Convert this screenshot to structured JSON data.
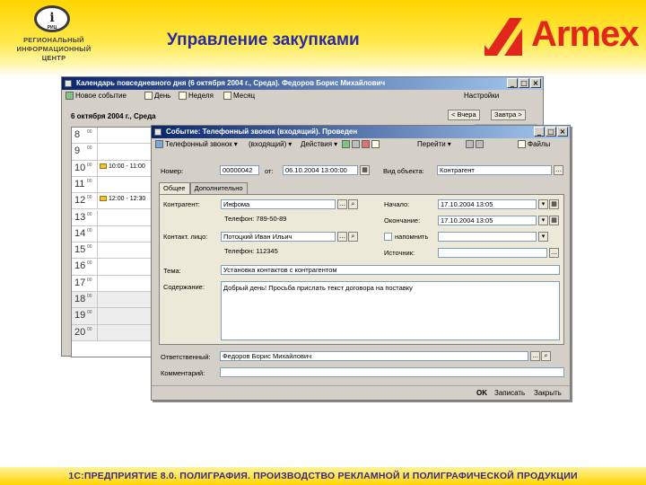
{
  "slide": {
    "title": "Управление закупками",
    "logo_left": {
      "seal_letter": "i",
      "seal_text": "РИЦ",
      "org_lines": [
        "РЕГИОНАЛЬНЫЙ",
        "ИНФОРМАЦИОННЫЙ",
        "ЦЕНТР"
      ]
    },
    "logo_right": {
      "brand": "Armex"
    },
    "footer": "1С:ПРЕДПРИЯТИЕ 8.0. ПОЛИГРАФИЯ. ПРОИЗВОДСТВО РЕКЛАМНОЙ И ПОЛИГРАФИЧЕСКОЙ ПРОДУКЦИИ",
    "colors": {
      "header_yellow": "#ffd400",
      "title_blue": "#2a2aa0",
      "brand_red": "#e1261c",
      "window_title_blue": "#0a246a"
    }
  },
  "calendar_window": {
    "title": "Календарь повседневного дня (6 октября 2004 г., Среда). Федоров Борис Михайлович",
    "toolbar": {
      "new_event": "Новое событие",
      "day": "День",
      "week": "Неделя",
      "month": "Месяц",
      "settings": "Настройки"
    },
    "date_header": "6 октября 2004 г., Среда",
    "nav": {
      "prev": "< Вчера",
      "next": "Завтра >"
    },
    "hours": [
      "8",
      "9",
      "10",
      "11",
      "12",
      "13",
      "14",
      "15",
      "16",
      "17",
      "18",
      "19",
      "20"
    ],
    "hour_suffix": "00",
    "events": [
      {
        "hour": "10",
        "text": "10:00 - 11:00"
      },
      {
        "hour": "12",
        "text": "12:00 - 12:30"
      }
    ]
  },
  "event_dialog": {
    "title": "Событие: Телефонный звонок (входящий). Проведен",
    "toolbar": {
      "type": "Телефонный звонок",
      "direction": "(входящий)",
      "actions": "Действия",
      "goto": "Перейти",
      "files": "Файлы"
    },
    "fields": {
      "number_label": "Номер:",
      "number_value": "00000042",
      "date_label": "от:",
      "date_value": "06.10.2004 13:00:00",
      "object_type_label": "Вид объекта:",
      "object_type_value": "Контрагент"
    },
    "tabs": [
      "Общее",
      "Дополнительно"
    ],
    "general": {
      "counterparty_label": "Контрагент:",
      "counterparty_value": "Инфома",
      "counterparty_phone": "Телефон: 789-50-89",
      "contact_label": "Контакт. лицо:",
      "contact_value": "Потоцкий Иван Ильич",
      "contact_phone": "Телефон: 112345",
      "start_label": "Начало:",
      "start_value": "17.10.2004 13:05",
      "end_label": "Окончание:",
      "end_value": "17.10.2004 13:05",
      "remind_label": "напомнить",
      "source_label": "Источник:",
      "subject_label": "Тема:",
      "subject_value": "Установка контактов с контрагентом",
      "content_label": "Содержание:",
      "content_value": "Добрый день! Просьба прислать текст договора на поставку"
    },
    "responsible_label": "Ответственный:",
    "responsible_value": "Федоров Борис Михайлович",
    "comment_label": "Комментарий:",
    "buttons": {
      "ok": "OK",
      "save": "Записать",
      "close": "Закрыть"
    }
  }
}
